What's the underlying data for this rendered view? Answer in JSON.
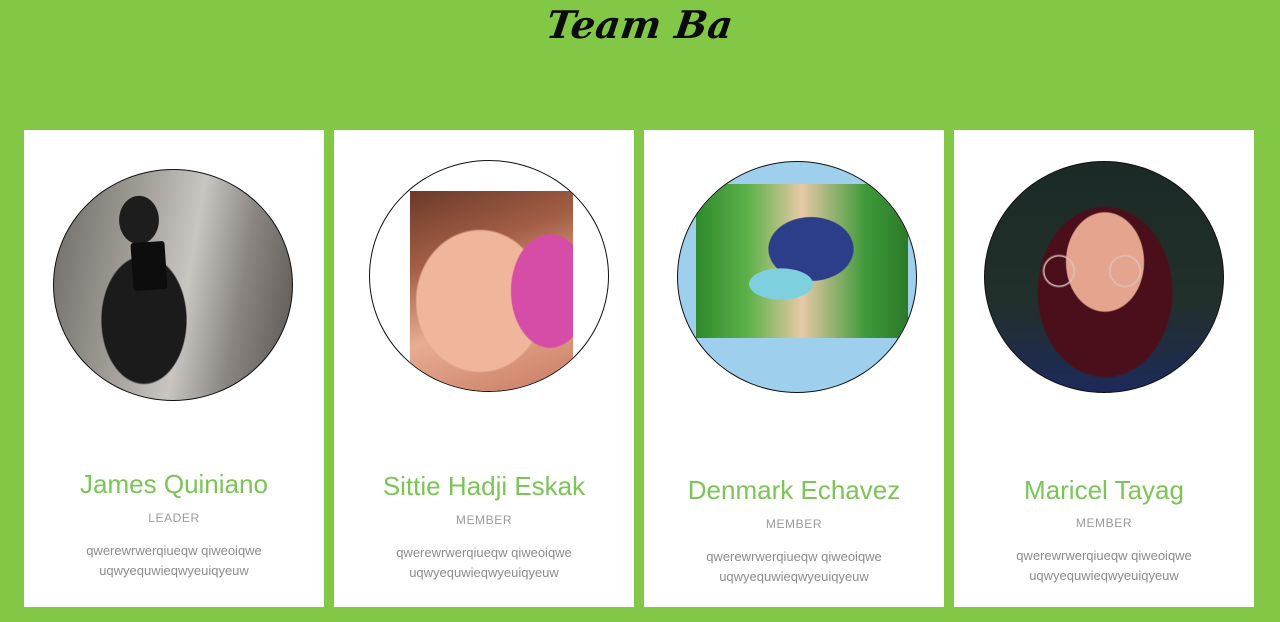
{
  "page": {
    "title": "Team Ba",
    "background_color": "#82c846",
    "accent_color": "#7bc456"
  },
  "members": [
    {
      "name": "James Quiniano",
      "role": "LEADER",
      "description": "qwerewrwerqiueqw qiweoiqwe uqwyequwieqwyeuiqyeuw",
      "photo_icon": "member-photo"
    },
    {
      "name": "Sittie Hadji Eskak",
      "role": "MEMBER",
      "description": "qwerewrwerqiueqw qiweoiqwe uqwyequwieqwyeuiqyeuw",
      "photo_icon": "member-photo"
    },
    {
      "name": "Denmark Echavez",
      "role": "MEMBER",
      "description": "qwerewrwerqiueqw qiweoiqwe uqwyequwieqwyeuiqyeuw",
      "photo_icon": "member-photo"
    },
    {
      "name": "Maricel Tayag",
      "role": "MEMBER",
      "description": "qwerewrwerqiueqw qiweoiqwe uqwyequwieqwyeuiqyeuw",
      "photo_icon": "member-photo"
    }
  ]
}
